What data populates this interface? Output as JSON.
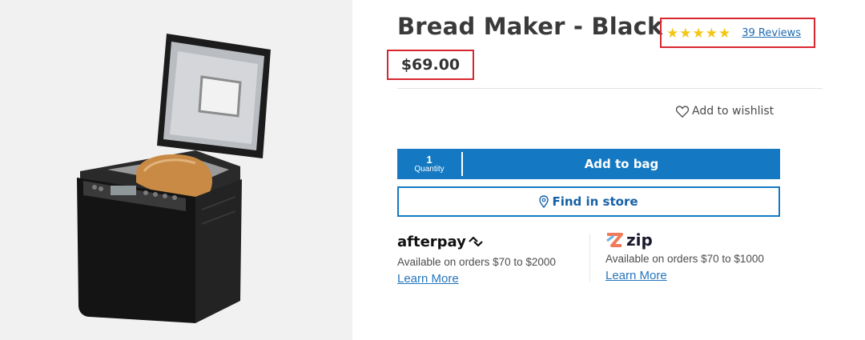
{
  "product": {
    "title": "Bread Maker - Black",
    "price": "$69.00",
    "image": "bread-maker-image",
    "rating": {
      "stars": 5,
      "reviews_label": "39 Reviews",
      "star_color": "#f3c515"
    }
  },
  "actions": {
    "wishlist_label": "Add to wishlist",
    "quantity_value": "1",
    "quantity_label": "Quantity",
    "add_to_bag_label": "Add to bag",
    "find_in_store_label": "Find in store"
  },
  "payments": {
    "afterpay": {
      "logo_text": "afterpay",
      "availability": "Available on orders $70 to $2000",
      "learn_more": "Learn More"
    },
    "zip": {
      "logo_text": "zip",
      "availability": "Available on orders $70 to $1000",
      "learn_more": "Learn More"
    }
  },
  "colors": {
    "primary": "#1479c2",
    "highlight_border": "#d8262f",
    "link": "#2575bc"
  }
}
